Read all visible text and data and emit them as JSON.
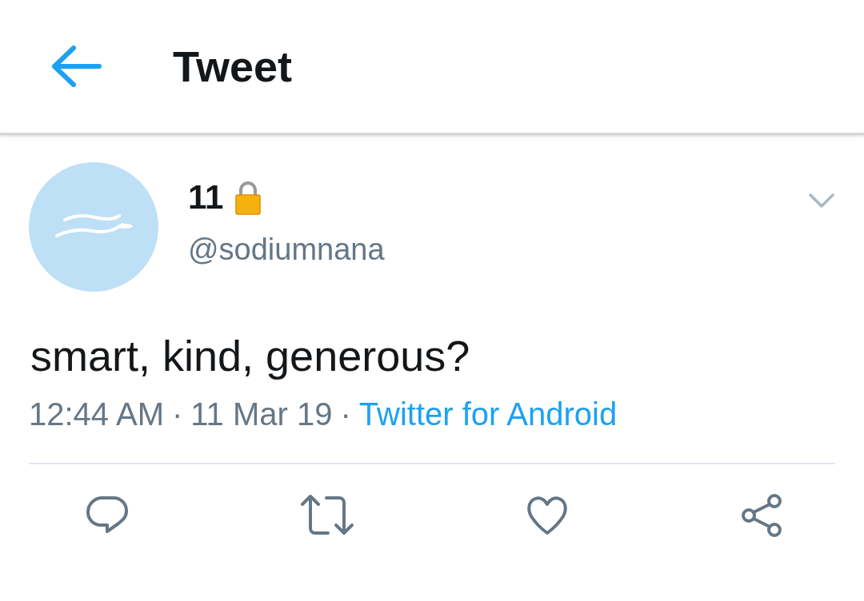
{
  "header": {
    "title": "Tweet"
  },
  "tweet": {
    "name": "11",
    "protected": true,
    "handle": "@sodiumnana",
    "text": "smart, kind, generous?",
    "meta": [
      {
        "kind": "time",
        "text": "12:44 AM"
      },
      {
        "kind": "separator",
        "text": "·"
      },
      {
        "kind": "date",
        "text": "11 Mar 19"
      },
      {
        "kind": "separator",
        "text": "·"
      },
      {
        "kind": "link",
        "text": "Twitter for Android"
      }
    ]
  },
  "actions": [
    {
      "kind": "reply"
    },
    {
      "kind": "retweet"
    },
    {
      "kind": "like"
    },
    {
      "kind": "share"
    }
  ]
}
